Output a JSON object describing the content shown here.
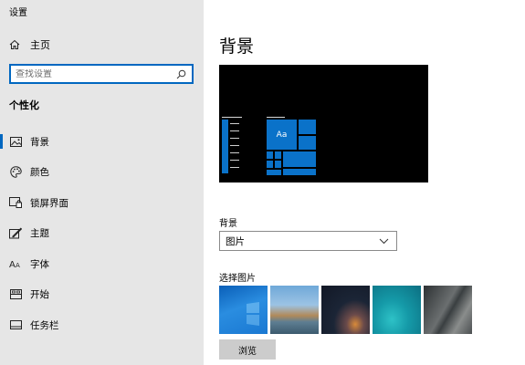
{
  "app": {
    "title": "设置"
  },
  "sidebar": {
    "home_label": "主页",
    "search_placeholder": "查找设置",
    "section_title": "个性化",
    "items": [
      {
        "label": "背景",
        "icon": "picture-icon",
        "selected": true
      },
      {
        "label": "颜色",
        "icon": "palette-icon",
        "selected": false
      },
      {
        "label": "锁屏界面",
        "icon": "lock-screen-icon",
        "selected": false
      },
      {
        "label": "主题",
        "icon": "theme-brush-icon",
        "selected": false
      },
      {
        "label": "字体",
        "icon": "font-icon",
        "selected": false
      },
      {
        "label": "开始",
        "icon": "start-grid-icon",
        "selected": false
      },
      {
        "label": "任务栏",
        "icon": "taskbar-icon",
        "selected": false
      }
    ]
  },
  "main": {
    "title": "背景",
    "preview": {
      "tile_label": "Aa"
    },
    "background_label": "背景",
    "background_value": "图片",
    "choose_picture_label": "选择图片",
    "browse_label": "浏览"
  },
  "colors": {
    "accent": "#0067c0",
    "sidebar_bg": "#e6e6e6",
    "tile": "#0a72c9"
  }
}
